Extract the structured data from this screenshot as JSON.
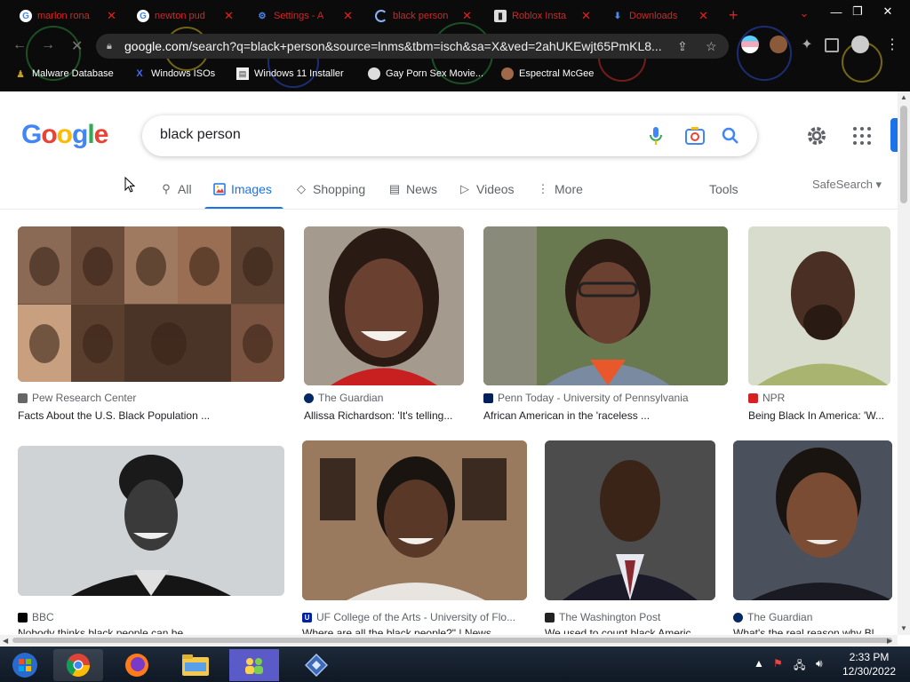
{
  "browser": {
    "tabs": [
      {
        "title": "marlon rona",
        "icon": "google-g-icon"
      },
      {
        "title": "newton pud",
        "icon": "google-g-icon"
      },
      {
        "title": "Settings - A",
        "icon": "gear-icon"
      },
      {
        "title": "black person",
        "icon": "loading-spinner-icon"
      },
      {
        "title": "Roblox Insta",
        "icon": "roblox-icon"
      },
      {
        "title": "Downloads",
        "icon": "download-icon"
      }
    ],
    "url_host": "google.com",
    "url_path": "/search?q=black+person&source=lnms&tbm=isch&sa=X&ved=2ahUKEwjt65PmKL8...",
    "bookmarks": [
      {
        "label": "Malware Database",
        "icon": "bug-icon"
      },
      {
        "label": "Windows ISOs",
        "icon": "x-icon"
      },
      {
        "label": "Windows 11 Installer",
        "icon": "doc-icon"
      },
      {
        "label": "Gay Porn Sex Movie...",
        "icon": "site-icon"
      },
      {
        "label": "Espectral McGee",
        "icon": "site-icon"
      }
    ]
  },
  "google": {
    "logo_letters": [
      "G",
      "o",
      "o",
      "g",
      "l",
      "e"
    ],
    "logo_colors": [
      "#4285f4",
      "#ea4335",
      "#fbbc05",
      "#4285f4",
      "#34a853",
      "#ea4335"
    ],
    "query": "black person",
    "tabs": [
      {
        "label": "All",
        "icon": "search-icon"
      },
      {
        "label": "Images",
        "icon": "image-icon"
      },
      {
        "label": "Shopping",
        "icon": "tag-icon"
      },
      {
        "label": "News",
        "icon": "news-icon"
      },
      {
        "label": "Videos",
        "icon": "play-icon"
      },
      {
        "label": "More",
        "icon": "more-vert-icon"
      }
    ],
    "tools_label": "Tools",
    "safesearch_label": "SafeSearch ▾"
  },
  "results": [
    {
      "source": "Pew Research Center",
      "title": "Facts About the U.S. Black Population ...",
      "fav_color": "#666",
      "img_color": "#8a6650"
    },
    {
      "source": "The Guardian",
      "title": "Allissa Richardson: 'It's telling...",
      "fav_color": "#052962",
      "img_color": "#6b4a3a"
    },
    {
      "source": "Penn Today - University of Pennsylvania",
      "title": "African American in the 'raceless ...",
      "fav_color": "#011f5b",
      "img_color": "#5d6a4a"
    },
    {
      "source": "NPR",
      "title": "Being Black In America: 'W...",
      "fav_color": "#d62021",
      "img_color": "#c9cfb8"
    },
    {
      "source": "BBC",
      "title": "Nobody thinks black people can be ...",
      "fav_color": "#000",
      "img_color": "#c8ccd0"
    },
    {
      "source": "UF College of the Arts - University of Flo...",
      "title": "Where are all the black people?\" | News ...",
      "fav_color": "#0021a5",
      "img_color": "#8c6e58"
    },
    {
      "source": "The Washington Post",
      "title": "We used to count black Americ...",
      "fav_color": "#222",
      "img_color": "#4a4a4a"
    },
    {
      "source": "The Guardian",
      "title": "What's the real reason why Bl...",
      "fav_color": "#052962",
      "img_color": "#3a3f48"
    }
  ],
  "taskbar": {
    "time": "2:33 PM",
    "date": "12/30/2022"
  }
}
